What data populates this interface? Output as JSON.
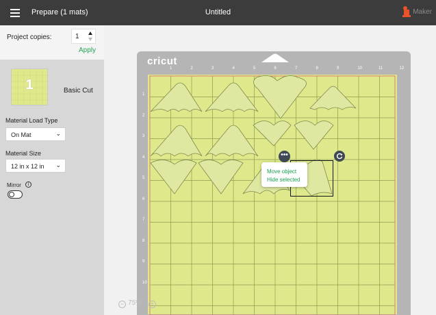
{
  "header": {
    "title": "Prepare (1 mats)",
    "document_title": "Untitled",
    "machine": "Maker"
  },
  "project": {
    "copies_label": "Project copies:",
    "copies_value": "1",
    "apply_label": "Apply"
  },
  "mat_card": {
    "number": "1",
    "name": "Basic Cut"
  },
  "material_load": {
    "label": "Material Load Type",
    "value": "On Mat"
  },
  "material_size": {
    "label": "Material Size",
    "value": "12 in x 12 in"
  },
  "mirror": {
    "label": "Mirror",
    "enabled": false
  },
  "mat": {
    "brand": "cricut",
    "top_ruler": [
      "1",
      "2",
      "3",
      "4",
      "5",
      "6",
      "7",
      "8",
      "9",
      "10",
      "11",
      "12"
    ],
    "left_ruler": [
      "1",
      "2",
      "3",
      "4",
      "5",
      "6",
      "7",
      "8",
      "9",
      "10"
    ],
    "right_ruler": [
      "12",
      "11",
      "10",
      "9",
      "8",
      "7",
      "6",
      "5",
      "4",
      "3",
      "2",
      "1"
    ],
    "color": "#dfe98c"
  },
  "context_menu": {
    "items": [
      "Move object",
      "Hide selected"
    ]
  },
  "zoom": {
    "level": "75%"
  },
  "colors": {
    "accent": "#26a556",
    "topbar": "#3c3c3c"
  }
}
